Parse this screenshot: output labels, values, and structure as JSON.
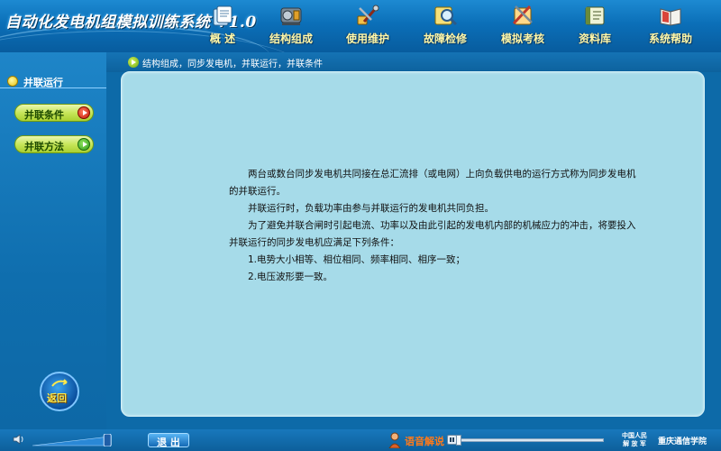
{
  "app": {
    "title": "自动化发电机组模拟训练系统 V1.0"
  },
  "nav": [
    {
      "label": "概 述",
      "icon": "document-stack-icon"
    },
    {
      "label": "结构组成",
      "icon": "generator-machine-icon"
    },
    {
      "label": "使用维护",
      "icon": "maintenance-tools-icon"
    },
    {
      "label": "故障检修",
      "icon": "fault-inspection-icon"
    },
    {
      "label": "模拟考核",
      "icon": "exam-tools-icon"
    },
    {
      "label": "资料库",
      "icon": "database-book-icon"
    },
    {
      "label": "系统帮助",
      "icon": "help-book-icon"
    }
  ],
  "breadcrumb": "结构组成，同步发电机，并联运行，并联条件",
  "sidebar": {
    "title": "并联运行",
    "items": [
      {
        "label": "并联条件",
        "state": "active"
      },
      {
        "label": "并联方法",
        "state": "normal"
      }
    ],
    "back_label": "返回"
  },
  "content": {
    "paragraphs": [
      "两台或数台同步发电机共同接在总汇流排（或电网）上向负载供电的运行方式称为同步发电机的并联运行。",
      "并联运行时，负载功率由参与并联运行的发电机共同负担。",
      "为了避免并联合闸时引起电流、功率以及由此引起的发电机内部的机械应力的冲击，将要投入并联运行的同步发电机应满足下列条件：",
      "1.电势大小相等、相位相同、频率相同、相序一致；",
      "2.电压波形要一致。"
    ]
  },
  "footer": {
    "volume_level": 0.9,
    "exit_label": "退 出",
    "audio_label": "语音解说",
    "audio_progress": 0.0,
    "org_line1": "中国人民",
    "org_line2": "解 放 军",
    "org_name": "重庆通信学院"
  },
  "colors": {
    "header_blue": "#0b6fb8",
    "panel_bg": "#a6dbe9",
    "nav_label": "#fff7a8",
    "button_green": "#c7e65a",
    "audio_orange": "#ff7a1a"
  }
}
